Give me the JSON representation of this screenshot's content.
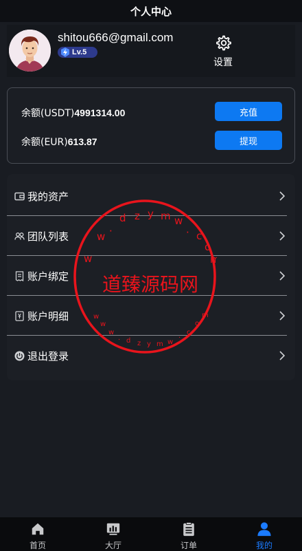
{
  "header": {
    "title": "个人中心"
  },
  "profile": {
    "email": "shitou666@gmail.com",
    "level": "Lv.5",
    "settings_label": "设置"
  },
  "balances": {
    "usdt_label": "余额(USDT)",
    "usdt_value": "4991314.00",
    "usdt_button": "充值",
    "eur_label": "余额(EUR)",
    "eur_value": "613.87",
    "eur_button": "提现"
  },
  "menu": {
    "items": [
      {
        "label": "我的资产",
        "icon": "wallet-icon"
      },
      {
        "label": "团队列表",
        "icon": "team-icon"
      },
      {
        "label": "账户绑定",
        "icon": "receipt-icon"
      },
      {
        "label": "账户明细",
        "icon": "ledger-icon"
      },
      {
        "label": "退出登录",
        "icon": "power-icon"
      }
    ]
  },
  "watermark": {
    "main": "道臻源码网",
    "top": "dzym",
    "bottom": "dzym"
  },
  "tabbar": {
    "items": [
      {
        "label": "首页",
        "icon": "home-icon"
      },
      {
        "label": "大厅",
        "icon": "hall-icon"
      },
      {
        "label": "订单",
        "icon": "clipboard-icon"
      },
      {
        "label": "我的",
        "icon": "person-icon"
      }
    ],
    "active_color": "#1b7bff"
  },
  "colors": {
    "accent": "#0d79f2",
    "stamp": "#e8141c"
  }
}
